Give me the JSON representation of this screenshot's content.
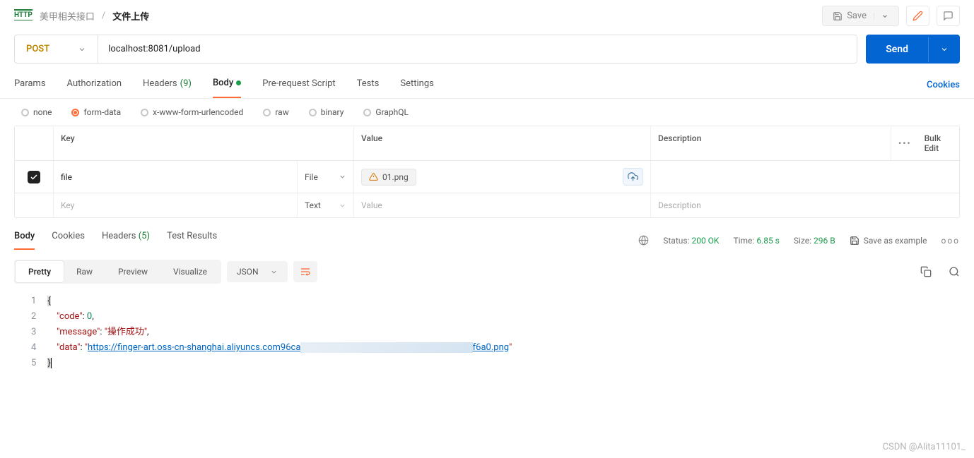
{
  "header": {
    "badge": "HTTP",
    "crumb_parent": "美甲相关接口",
    "crumb_current": "文件上传",
    "save_label": "Save"
  },
  "request": {
    "method": "POST",
    "url": "localhost:8081/upload",
    "send_label": "Send"
  },
  "tabs": {
    "params": "Params",
    "authorization": "Authorization",
    "headers_label": "Headers",
    "headers_count": "(9)",
    "body": "Body",
    "prerequest": "Pre-request Script",
    "tests": "Tests",
    "settings": "Settings",
    "cookies": "Cookies"
  },
  "body_types": {
    "none": "none",
    "formdata": "form-data",
    "xwww": "x-www-form-urlencoded",
    "raw": "raw",
    "binary": "binary",
    "graphql": "GraphQL"
  },
  "table": {
    "header_key": "Key",
    "header_value": "Value",
    "header_desc": "Description",
    "bulk_edit": "Bulk Edit",
    "row": {
      "key": "file",
      "type": "File",
      "filename": "01.png"
    },
    "placeholder_key": "Key",
    "placeholder_type": "Text",
    "placeholder_value": "Value",
    "placeholder_desc": "Description"
  },
  "response_tabs": {
    "body": "Body",
    "cookies": "Cookies",
    "headers_label": "Headers",
    "headers_count": "(5)",
    "test_results": "Test Results"
  },
  "response_meta": {
    "status_label": "Status:",
    "status_value": "200 OK",
    "time_label": "Time:",
    "time_value": "6.85 s",
    "size_label": "Size:",
    "size_value": "296 B",
    "save_as": "Save as example"
  },
  "toolbar": {
    "pretty": "Pretty",
    "raw": "Raw",
    "preview": "Preview",
    "visualize": "Visualize",
    "format": "JSON"
  },
  "code": {
    "l1": "{",
    "l2_key": "\"code\"",
    "l2_val": "0",
    "l3_key": "\"message\"",
    "l3_val": "\"操作成功\"",
    "l4_key": "\"data\"",
    "l4_url_a": "https://finger-art.oss-cn-shanghai.aliyuncs.com96ca",
    "l4_url_b": "f6a0.png",
    "l5": "}"
  },
  "watermark": "CSDN @Alita11101_"
}
